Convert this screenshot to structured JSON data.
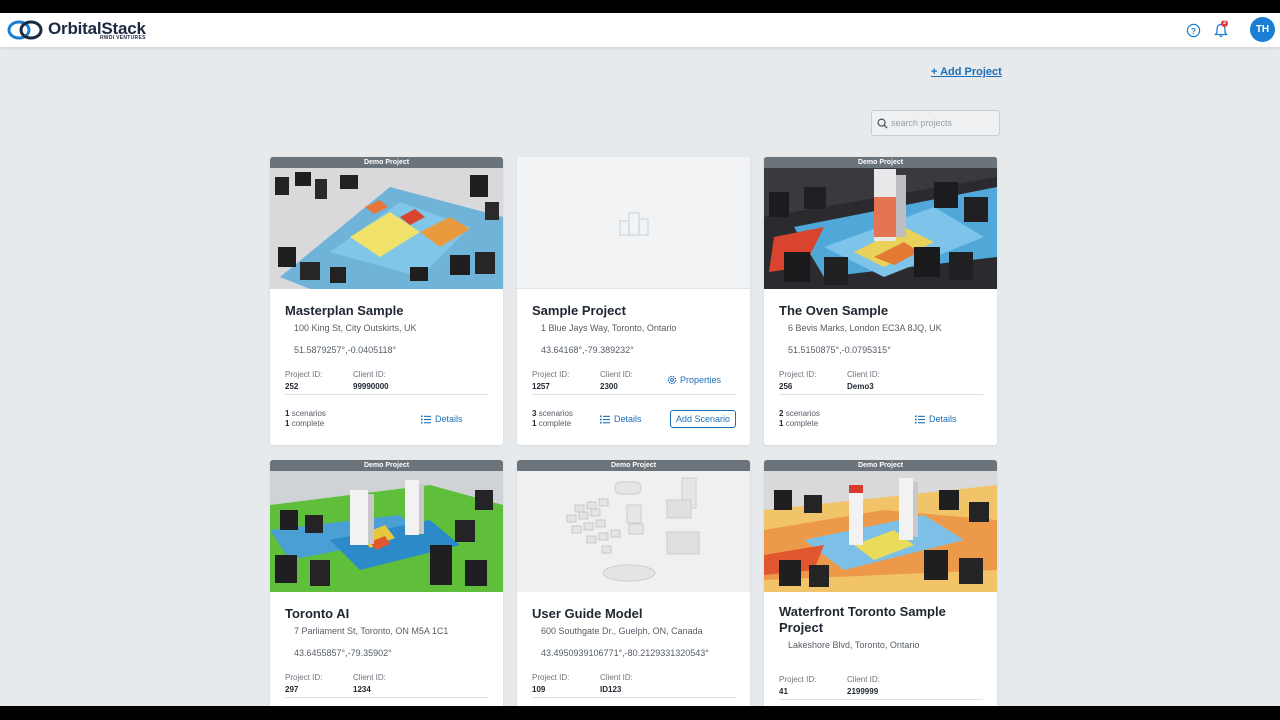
{
  "header": {
    "logo_name": "OrbitalStack",
    "logo_sub": "RWDI VENTURES",
    "notification_count": "2",
    "avatar_initials": "TH"
  },
  "toolbar": {
    "add_project_label": "+ Add Project",
    "search_placeholder": "search projects"
  },
  "labels": {
    "demo_band": "Demo Project",
    "project_id": "Project ID:",
    "client_id": "Client ID:",
    "details": "Details",
    "properties": "Properties",
    "add_scenario": "Add Scenario",
    "scenarios": "scenarios",
    "complete": "complete"
  },
  "projects": [
    {
      "title": "Masterplan Sample",
      "address": "100 King St, City Outskirts, UK",
      "coords": "51.5879257°,-0.0405118°",
      "project_id": "252",
      "client_id": "99990000",
      "scenarios": "1",
      "complete": "1",
      "demo": true
    },
    {
      "title": "Sample Project",
      "address": "1 Blue Jays Way, Toronto, Ontario",
      "coords": "43.64168°,-79.389232°",
      "project_id": "1257",
      "client_id": "2300",
      "scenarios": "3",
      "complete": "1",
      "demo": false
    },
    {
      "title": "The Oven Sample",
      "address": "6 Bevis Marks, London EC3A 8JQ, UK",
      "coords": "51.5150875°,-0.0795315°",
      "project_id": "256",
      "client_id": "Demo3",
      "scenarios": "2",
      "complete": "1",
      "demo": true
    },
    {
      "title": "Toronto AI",
      "address": "7 Parliament St, Toronto, ON M5A 1C1",
      "coords": "43.6455857°,-79.35902°",
      "project_id": "297",
      "client_id": "1234",
      "demo": true
    },
    {
      "title": "User Guide Model",
      "address": "600 Southgate Dr., Guelph, ON, Canada",
      "coords": "43.4950939106771°,-80.2129331320543°",
      "project_id": "109",
      "client_id": "ID123",
      "demo": true
    },
    {
      "title": "Waterfront Toronto Sample Project",
      "address": "Lakeshore Blvd, Toronto, Ontario",
      "project_id": "41",
      "client_id": "2199999",
      "demo": true
    }
  ],
  "colors": {
    "accent": "#1b6fb8",
    "avatar": "#1a7fd4",
    "badge": "#e23c3c",
    "background": "#e7eaed"
  }
}
